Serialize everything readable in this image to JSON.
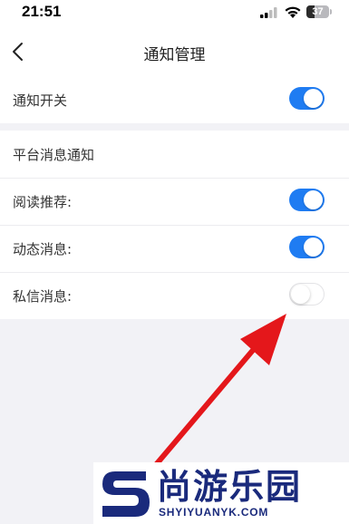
{
  "status_bar": {
    "time": "21:51",
    "battery_level": 37,
    "battery_text": "37"
  },
  "header": {
    "title": "通知管理",
    "back_icon": "chevron-left-icon"
  },
  "master": {
    "label": "通知开关",
    "enabled": true
  },
  "platform": {
    "section_label": "平台消息通知",
    "items": [
      {
        "label": "阅读推荐:",
        "enabled": true
      },
      {
        "label": "动态消息:",
        "enabled": true
      },
      {
        "label": "私信消息:",
        "enabled": false
      }
    ]
  },
  "colors": {
    "toggle_on": "#1f7cf2",
    "arrow": "#e4171b",
    "watermark": "#1a2a7c"
  },
  "watermark": {
    "title": "尚游乐园",
    "subtitle": "SHYIYUANYK.COM"
  }
}
